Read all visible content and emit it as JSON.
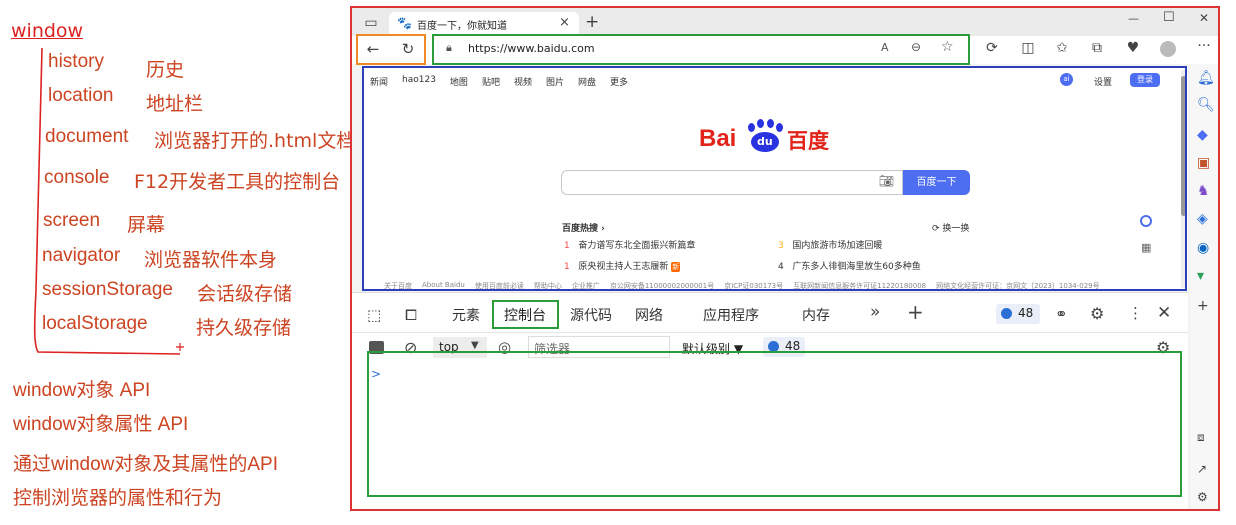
{
  "annotations": {
    "root": "window",
    "items": [
      {
        "key": "history",
        "cn": "历史"
      },
      {
        "key": "location",
        "cn": "地址栏"
      },
      {
        "key": "document",
        "cn": "浏览器打开的.html文档"
      },
      {
        "key": "console",
        "cn": "F12开发者工具的控制台"
      },
      {
        "key": "screen",
        "cn": "屏幕"
      },
      {
        "key": "navigator",
        "cn": "浏览器软件本身"
      },
      {
        "key": "sessionStorage",
        "cn": "会话级存储"
      },
      {
        "key": "localStorage",
        "cn": "持久级存储"
      }
    ],
    "notes": [
      "window对象   API",
      "window对象属性   API",
      "通过window对象及其属性的API",
      "控制浏览器的属性和行为"
    ]
  },
  "browser": {
    "tab_title": "百度一下，你就知道",
    "tab_close": "×",
    "new_tab": "+",
    "window_controls": {
      "minimize": "—",
      "maximize": "☐",
      "close": "✕"
    },
    "url": "https://www.baidu.com",
    "zoom_badge": "A",
    "more": "···"
  },
  "baidu": {
    "nav_left": [
      "新闻",
      "hao123",
      "地图",
      "贴吧",
      "视频",
      "图片",
      "网盘",
      "更多"
    ],
    "nav_right_settings": "设置",
    "nav_right_login": "登录",
    "logo_bai": "Bai",
    "logo_du": "du",
    "logo_cn": "百度",
    "search_button": "百度一下",
    "hot_title": "百度热搜",
    "hot_refresh": "换一换",
    "hot_items": [
      {
        "rank": "1",
        "text": "奋力谱写东北全面振兴新篇章"
      },
      {
        "rank": "3",
        "text": "国内旅游市场加速回暖"
      },
      {
        "rank": "1",
        "text": "原央视主持人王志履新",
        "badge": "新"
      },
      {
        "rank": "4",
        "text": "广东多人徘徊海里放生60多种鱼"
      }
    ],
    "footer": [
      "关于百度",
      "About Baidu",
      "使用百度前必读",
      "帮助中心",
      "企业推广",
      "京公网安备11000002000001号",
      "京ICP证030173号",
      "互联网新闻信息服务许可证11220180008",
      "网络文化经营许可证：京网文〔2023〕1034-029号"
    ]
  },
  "devtools": {
    "tabs": [
      "元素",
      "控制台",
      "源代码",
      "网络",
      "应用程序",
      "内存"
    ],
    "more_tabs": "»",
    "add_tab": "+",
    "issues_count": "48",
    "context": "top",
    "filter_placeholder": "筛选器",
    "level": "默认级别",
    "level_count": "48",
    "prompt": ">"
  },
  "colors": {
    "annotation_red": "#cc4422",
    "frame_red": "#dd3333",
    "orange": "#f08a24",
    "green": "#2a9d3a",
    "blue": "#2b3fb8",
    "baidu_blue": "#4e6ef2",
    "baidu_red": "#e2231a"
  }
}
